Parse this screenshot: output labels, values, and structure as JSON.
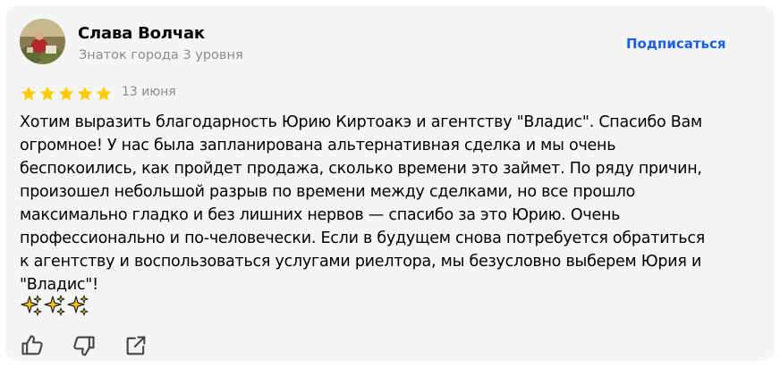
{
  "author": {
    "name": "Слава Волчак",
    "level": "Знаток города 3 уровня",
    "avatar_icon": "user-photo"
  },
  "subscribe_label": "Подписаться",
  "rating": {
    "value": 5,
    "max": 5,
    "color": "#fc0"
  },
  "date": "13 июня",
  "review_text": "Хотим выразить благодарность Юрию Киртоакэ и агентству \"Владис\". Спасибо Вам\nогромное! У нас была запланирована альтернативная сделка и мы очень\nбеспокоились, как пройдет продажа, сколько времени это займет. По ряду причин,\nпроизошел небольшой разрыв по времени между сделками, но все прошло\nмаксимально гладко и без лишних нервов — спасибо за это Юрию. Очень\nпрофессионально и по-человечески. Если в будущем снова потребуется обратиться\nк агентству и воспользоваться услугами риелтора, мы безусловно выберем Юрия и\n\"Владис\"!",
  "emoji": [
    "sparkles",
    "sparkles",
    "sparkles"
  ],
  "actions": [
    "like-icon",
    "dislike-icon",
    "share-icon"
  ],
  "colors": {
    "accent": "#1a5ee6",
    "muted": "#8c8c8c",
    "card_bg": "#f5f5f6"
  }
}
